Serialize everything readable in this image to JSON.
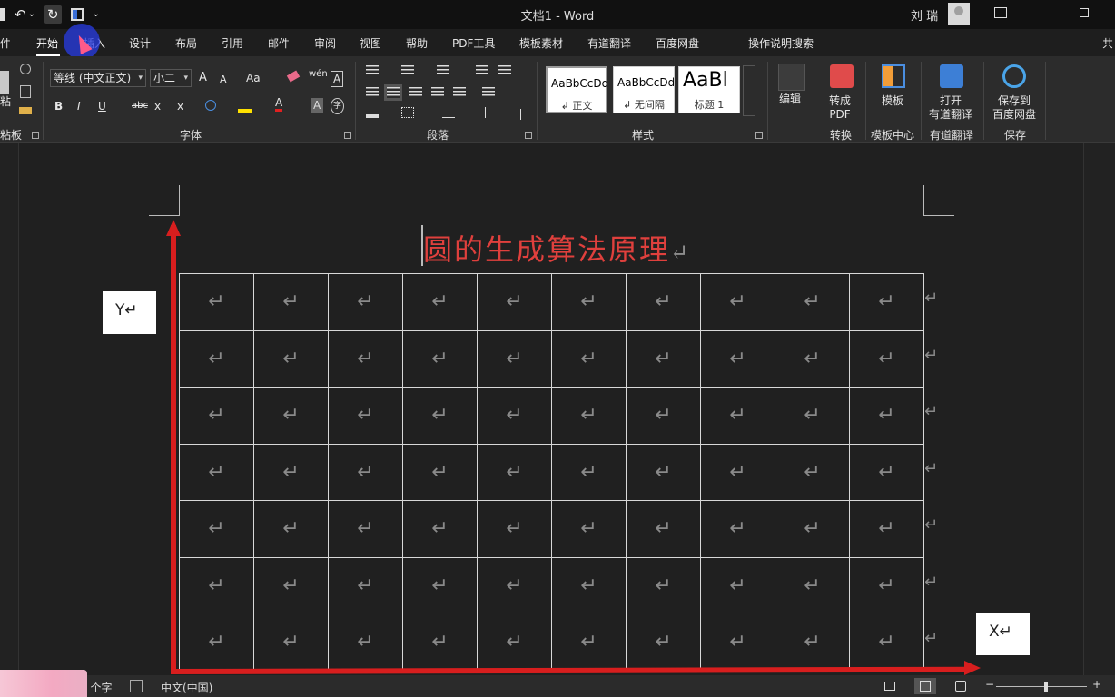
{
  "titlebar": {
    "doc_title": "文档1  -  Word",
    "user_name": "刘 瑞",
    "qat_undo": "↶",
    "qat_undo_drop": "⌄",
    "qat_redo": "↻",
    "qat_more": "⌄"
  },
  "tabs": {
    "file": "件",
    "home": "开始",
    "insert": "插入",
    "design": "设计",
    "layout": "布局",
    "references": "引用",
    "mailings": "邮件",
    "review": "审阅",
    "view": "视图",
    "help": "帮助",
    "pdf_tools": "PDF工具",
    "template_material": "模板素材",
    "youdao": "有道翻译",
    "baidu": "百度网盘",
    "tell_me": "操作说明搜索",
    "share": "共"
  },
  "ribbon": {
    "clipboard": {
      "paste_label": "粘",
      "group_label": "粘板"
    },
    "font": {
      "font_name": "等线 (中文正文)",
      "font_size": "小二",
      "grow": "A",
      "shrink": "A",
      "case": "Aa",
      "phonetic": "wén",
      "char_border": "A",
      "bold": "B",
      "italic": "I",
      "underline": "U",
      "strike": "abc",
      "subscript": "x",
      "superscript": "x",
      "font_color": "A",
      "char_shading": "A",
      "enclose": "字",
      "group_label": "字体"
    },
    "paragraph": {
      "group_label": "段落"
    },
    "styles": {
      "items": [
        {
          "sample": "AaBbCcDd",
          "name": "↲ 正文"
        },
        {
          "sample": "AaBbCcDd",
          "name": "↲ 无间隔"
        },
        {
          "sample": "AaBl",
          "name": "标题 1"
        }
      ],
      "group_label": "样式"
    },
    "editing": {
      "label": "编辑"
    },
    "convert": {
      "label": "转成\nPDF",
      "group_label": "转换"
    },
    "templates": {
      "label": "模板",
      "group_label": "模板中心"
    },
    "youdao": {
      "label": "打开\n有道翻译",
      "group_label": "有道翻译"
    },
    "save": {
      "label": "保存到\n百度网盘",
      "group_label": "保存"
    }
  },
  "document": {
    "heading": "圆的生成算法原理",
    "heading_mark": "↵",
    "cell_mark": "↵",
    "row_mark": "↵",
    "y_label": "Y↵",
    "x_label": "X↵",
    "grid": {
      "rows": 7,
      "cols": 10
    }
  },
  "statusbar": {
    "word_count": "0 个字",
    "language": "中文(中国)",
    "zoom_minus": "−",
    "zoom_plus": "+"
  },
  "colors": {
    "axis": "#d81e1e",
    "heading": "#e0403d"
  }
}
